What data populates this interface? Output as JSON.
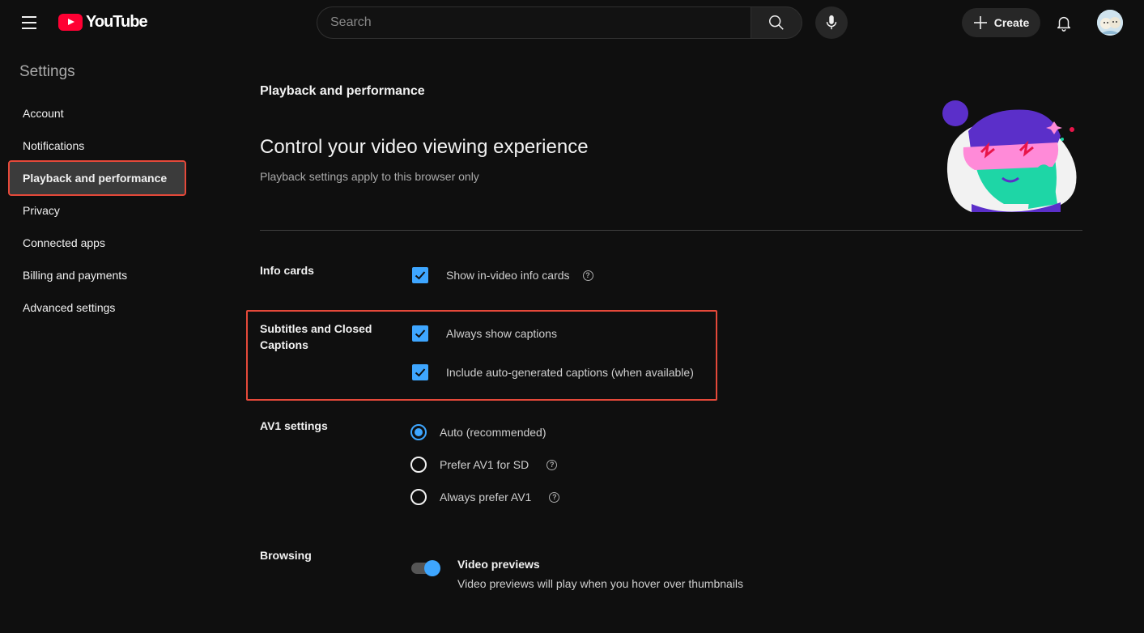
{
  "header": {
    "logo_text": "YouTube",
    "search_placeholder": "Search",
    "create_label": "Create"
  },
  "sidebar": {
    "title": "Settings",
    "items": [
      {
        "label": "Account"
      },
      {
        "label": "Notifications"
      },
      {
        "label": "Playback and performance",
        "active": true
      },
      {
        "label": "Privacy"
      },
      {
        "label": "Connected apps"
      },
      {
        "label": "Billing and payments"
      },
      {
        "label": "Advanced settings"
      }
    ]
  },
  "main": {
    "section_label": "Playback and performance",
    "heading": "Control your video viewing experience",
    "subheading": "Playback settings apply to this browser only",
    "info_cards": {
      "label": "Info cards",
      "option": {
        "label": "Show in-video info cards",
        "checked": true
      }
    },
    "captions": {
      "label": "Subtitles and Closed Captions",
      "options": [
        {
          "label": "Always show captions",
          "checked": true
        },
        {
          "label": "Include auto-generated captions (when available)",
          "checked": true
        }
      ]
    },
    "av1": {
      "label": "AV1 settings",
      "options": [
        {
          "label": "Auto (recommended)",
          "selected": true
        },
        {
          "label": "Prefer AV1 for SD",
          "selected": false
        },
        {
          "label": "Always prefer AV1",
          "selected": false
        }
      ]
    },
    "browsing": {
      "label": "Browsing",
      "toggle_title": "Video previews",
      "toggle_desc": "Video previews will play when you hover over thumbnails",
      "enabled": true
    },
    "help_glyph": "?"
  },
  "colors": {
    "accent": "#3ea6ff",
    "highlight": "#e5493a",
    "brand": "#ff0033"
  }
}
